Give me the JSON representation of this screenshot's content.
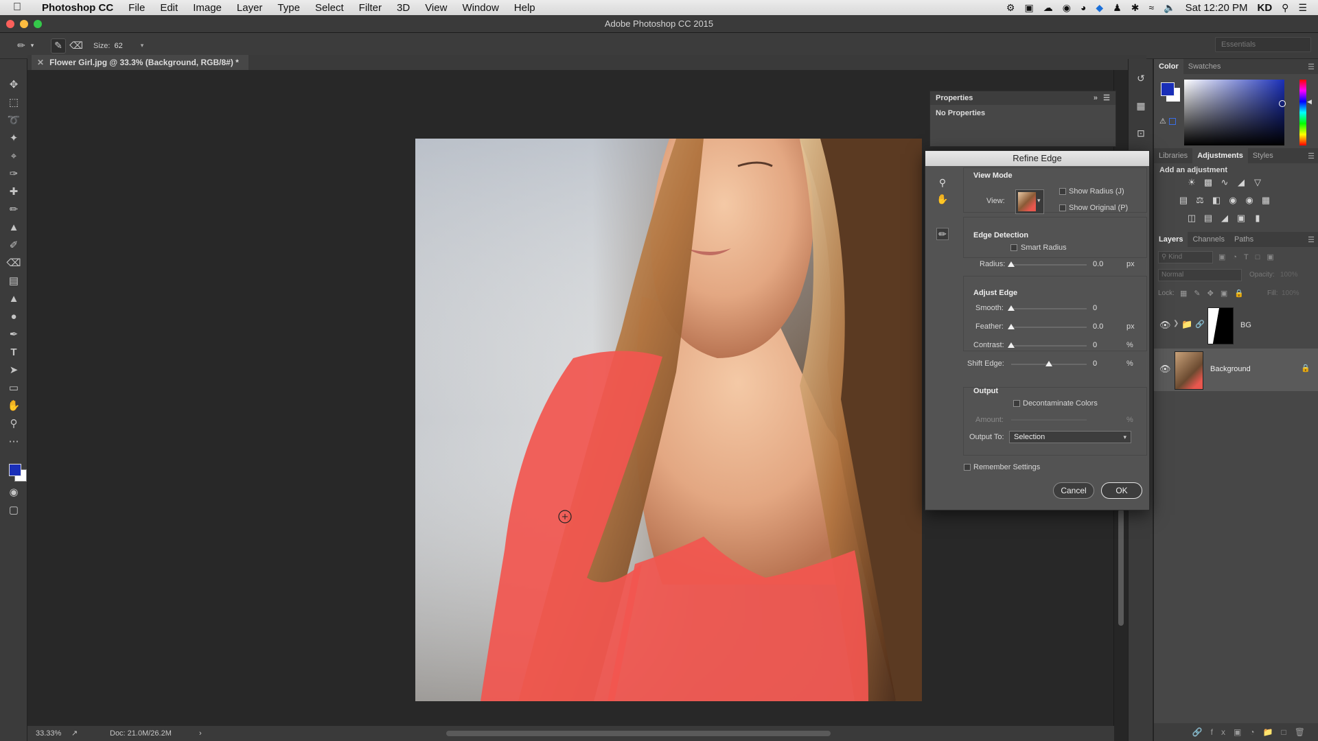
{
  "menubar": {
    "app_name": "Photoshop CC",
    "menus": [
      "File",
      "Edit",
      "Image",
      "Layer",
      "Type",
      "Select",
      "Filter",
      "3D",
      "View",
      "Window",
      "Help"
    ],
    "clock": "Sat 12:20 PM",
    "user": "KD"
  },
  "window": {
    "title": "Adobe Photoshop CC 2015"
  },
  "options_bar": {
    "size_label": "Size:",
    "size_value": "62",
    "workspace": "Essentials"
  },
  "document": {
    "tab_title": "Flower Girl.jpg @ 33.3% (Background, RGB/8#) *"
  },
  "status": {
    "zoom": "33.33%",
    "doc_size": "Doc: 21.0M/26.2M"
  },
  "properties": {
    "title": "Properties",
    "body": "No Properties"
  },
  "color_panel": {
    "tabs": [
      "Color",
      "Swatches"
    ],
    "foreground": "#1a2fb8",
    "background": "#ffffff"
  },
  "adjustments_panel": {
    "tabs": [
      "Libraries",
      "Adjustments",
      "Styles"
    ],
    "add_label": "Add an adjustment"
  },
  "layers_panel": {
    "tabs": [
      "Layers",
      "Channels",
      "Paths"
    ],
    "kind_placeholder": "Kind",
    "blend_mode": "Normal",
    "opacity_label": "Opacity:",
    "opacity_value": "100%",
    "lock_label": "Lock:",
    "fill_label": "Fill:",
    "fill_value": "100%",
    "layers": [
      {
        "name": "BG",
        "type": "group-mask"
      },
      {
        "name": "Background",
        "type": "locked"
      }
    ]
  },
  "refine_edge": {
    "title": "Refine Edge",
    "view_mode": {
      "heading": "View Mode",
      "view_label": "View:",
      "show_radius": "Show Radius (J)",
      "show_original": "Show Original (P)"
    },
    "edge_detection": {
      "heading": "Edge Detection",
      "smart_radius": "Smart Radius",
      "radius_label": "Radius:",
      "radius_value": "0.0",
      "radius_unit": "px"
    },
    "adjust_edge": {
      "heading": "Adjust Edge",
      "smooth_label": "Smooth:",
      "smooth_value": "0",
      "feather_label": "Feather:",
      "feather_value": "0.0",
      "feather_unit": "px",
      "contrast_label": "Contrast:",
      "contrast_value": "0",
      "contrast_unit": "%",
      "shift_label": "Shift Edge:",
      "shift_value": "0",
      "shift_unit": "%"
    },
    "output": {
      "heading": "Output",
      "decontaminate": "Decontaminate Colors",
      "amount_label": "Amount:",
      "amount_unit": "%",
      "output_to_label": "Output To:",
      "output_to_value": "Selection"
    },
    "remember_settings": "Remember Settings",
    "cancel_label": "Cancel",
    "ok_label": "OK"
  }
}
